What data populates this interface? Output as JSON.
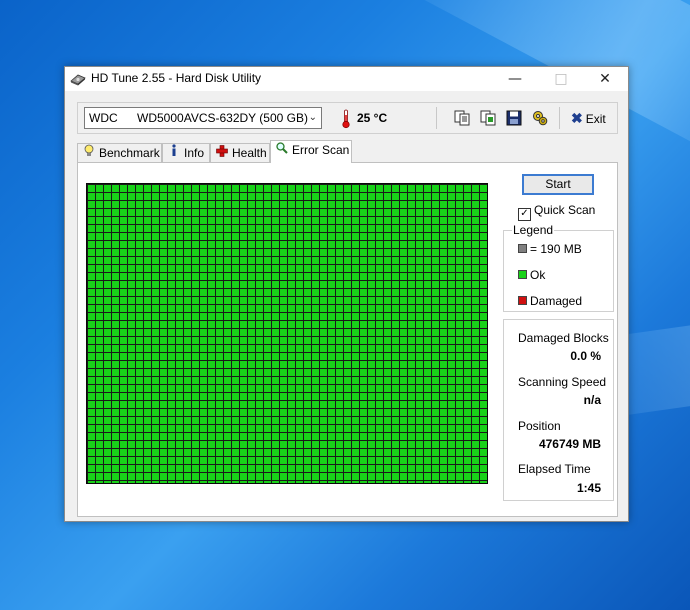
{
  "window": {
    "title": "HD Tune 2.55 - Hard Disk Utility"
  },
  "toolbar": {
    "drive_vendor": "WDC",
    "drive_model": "WD5000AVCS-632DY (500 GB)",
    "temperature": "25 °C",
    "exit_label": "Exit"
  },
  "tabs": [
    {
      "label": "Benchmark",
      "icon": "lightbulb-icon"
    },
    {
      "label": "Info",
      "icon": "info-icon"
    },
    {
      "label": "Health",
      "icon": "health-cross-icon"
    },
    {
      "label": "Error Scan",
      "icon": "magnifier-icon",
      "active": true
    }
  ],
  "scan": {
    "start_label": "Start",
    "quick_scan_label": "Quick Scan",
    "quick_scan_checked": true,
    "legend_title": "Legend",
    "legend": [
      {
        "label": "= 190 MB",
        "color": "#808080"
      },
      {
        "label": "Ok",
        "color": "#19d219"
      },
      {
        "label": "Damaged",
        "color": "#d01010"
      }
    ],
    "ok_color": "#19d219"
  },
  "stats": {
    "damaged_blocks_label": "Damaged Blocks",
    "damaged_blocks_value": "0.0 %",
    "scanning_speed_label": "Scanning Speed",
    "scanning_speed_value": "n/a",
    "position_label": "Position",
    "position_value": "476749 MB",
    "elapsed_time_label": "Elapsed Time",
    "elapsed_time_value": "1:45"
  }
}
